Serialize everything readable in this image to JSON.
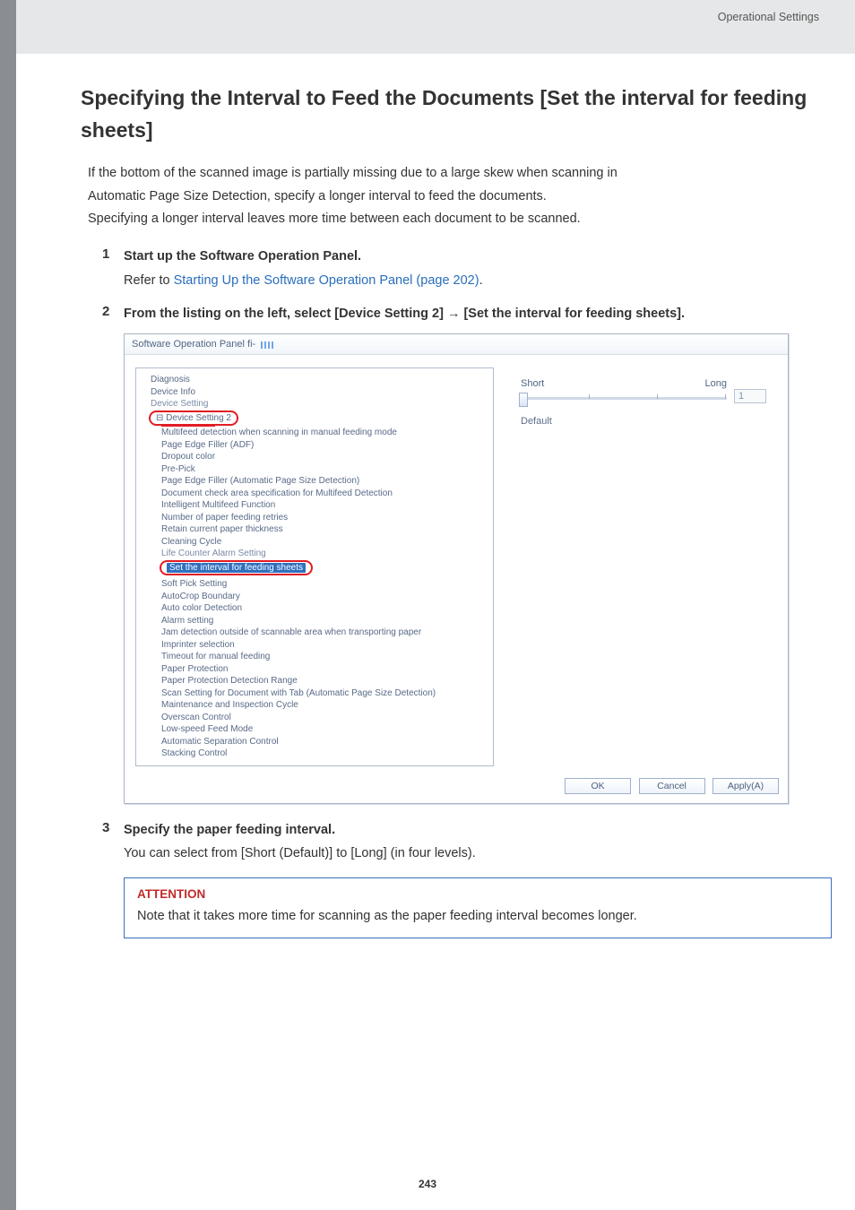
{
  "header": {
    "category": "Operational Settings"
  },
  "title": "Specifying the Interval to Feed the Documents [Set the interval for feeding sheets]",
  "intro": {
    "line1": "If the bottom of the scanned image is partially missing due to a large skew when scanning in",
    "line2": "Automatic Page Size Detection, specify a longer interval to feed the documents.",
    "line3": "Specifying a longer interval leaves more time between each document to be scanned."
  },
  "steps": [
    {
      "num": "1",
      "title": "Start up the Software Operation Panel.",
      "text_prefix": "Refer to ",
      "link": "Starting Up the Software Operation Panel (page 202)",
      "text_suffix": "."
    },
    {
      "num": "2",
      "title": "From the listing on the left, select [Device Setting 2] → [Set the interval for feeding sheets]."
    },
    {
      "num": "3",
      "title": "Specify the paper feeding interval.",
      "text": "You can select from [Short (Default)] to [Long] (in four levels)."
    }
  ],
  "sop": {
    "window_title": "Software Operation Panel fi-",
    "tree": [
      "Diagnosis",
      "Device Info",
      "Device Setting",
      "⊟ Device Setting 2",
      "Multifeed detection when scanning in manual feeding mode",
      "Page Edge Filler (ADF)",
      "Dropout color",
      "Pre-Pick",
      "Page Edge Filler (Automatic Page Size Detection)",
      "Document check area specification for Multifeed Detection",
      "Intelligent Multifeed Function",
      "Number of paper feeding retries",
      "Retain current paper thickness",
      "Cleaning Cycle",
      "Life Counter Alarm Setting",
      "Set the interval for feeding sheets",
      "Soft Pick Setting",
      "AutoCrop Boundary",
      "Auto color Detection",
      "Alarm setting",
      "Jam detection outside of scannable area when transporting paper",
      "Imprinter selection",
      "Timeout for manual feeding",
      "Paper Protection",
      "Paper Protection Detection Range",
      "Scan Setting for Document with Tab (Automatic Page Size Detection)",
      "Maintenance and Inspection Cycle",
      "Overscan Control",
      "Low-speed Feed Mode",
      "Automatic Separation Control",
      "Stacking Control"
    ],
    "right": {
      "short": "Short",
      "long": "Long",
      "value": "1",
      "default": "Default"
    },
    "buttons": {
      "ok": "OK",
      "cancel": "Cancel",
      "apply": "Apply(A)"
    }
  },
  "attention": {
    "title": "ATTENTION",
    "text": "Note that it takes more time for scanning as the paper feeding interval becomes longer."
  },
  "page_number": "243"
}
